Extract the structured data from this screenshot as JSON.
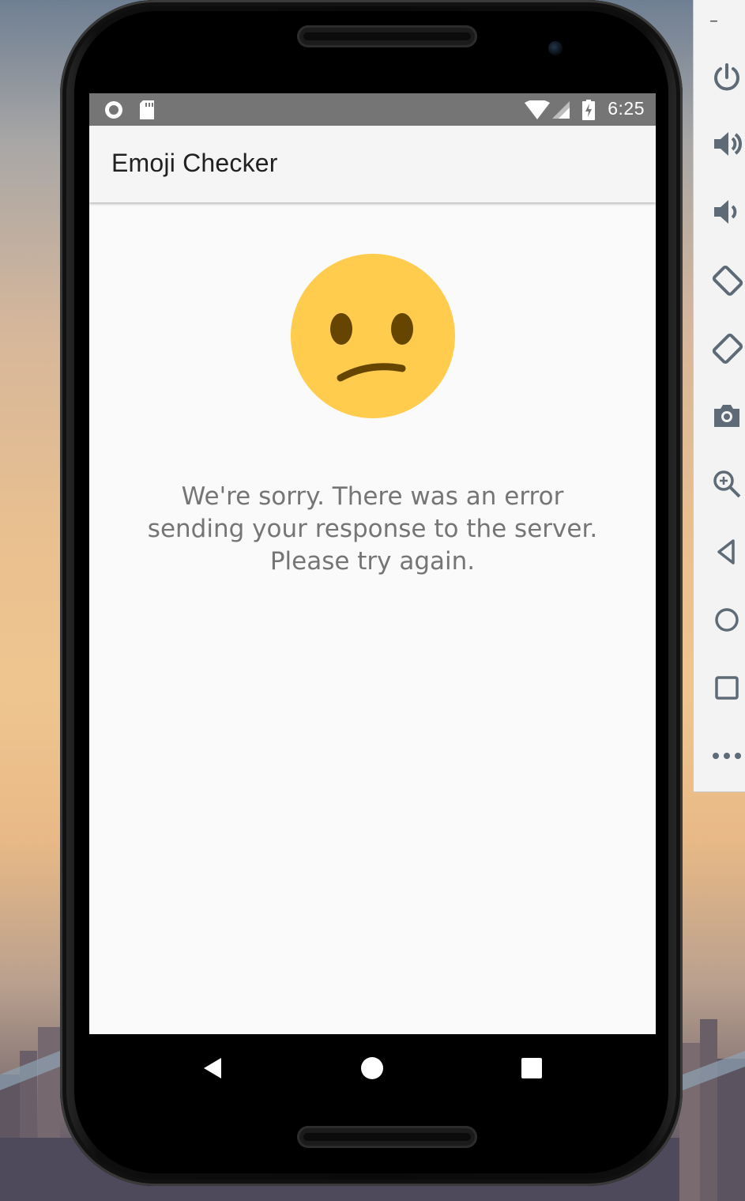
{
  "app": {
    "title": "Emoji Checker"
  },
  "status_bar": {
    "time": "6:25",
    "left_icons": [
      "circle-notification-icon",
      "sd-card-icon"
    ],
    "right_icons": [
      "wifi-icon",
      "cell-signal-icon",
      "battery-charging-icon"
    ]
  },
  "content": {
    "emoji": "confused-face-icon",
    "message": "We're sorry. There was an error\nsending your response to the server.\nPlease try again."
  },
  "nav_bar": {
    "buttons": [
      "back-icon",
      "home-icon",
      "recents-icon"
    ]
  },
  "emulator_toolbar": {
    "minimize_label": "–",
    "buttons": [
      "power-icon",
      "volume-up-icon",
      "volume-down-icon",
      "rotate-left-icon",
      "rotate-right-icon",
      "camera-icon",
      "zoom-icon",
      "back-icon",
      "home-icon",
      "overview-icon",
      "more-icon"
    ]
  },
  "colors": {
    "status_bar": "#757575",
    "app_bar": "#f5f5f5",
    "screen_bg": "#fafafa",
    "emoji_face": "#ffcc4d",
    "emoji_features": "#664500",
    "message_text": "#757575"
  }
}
